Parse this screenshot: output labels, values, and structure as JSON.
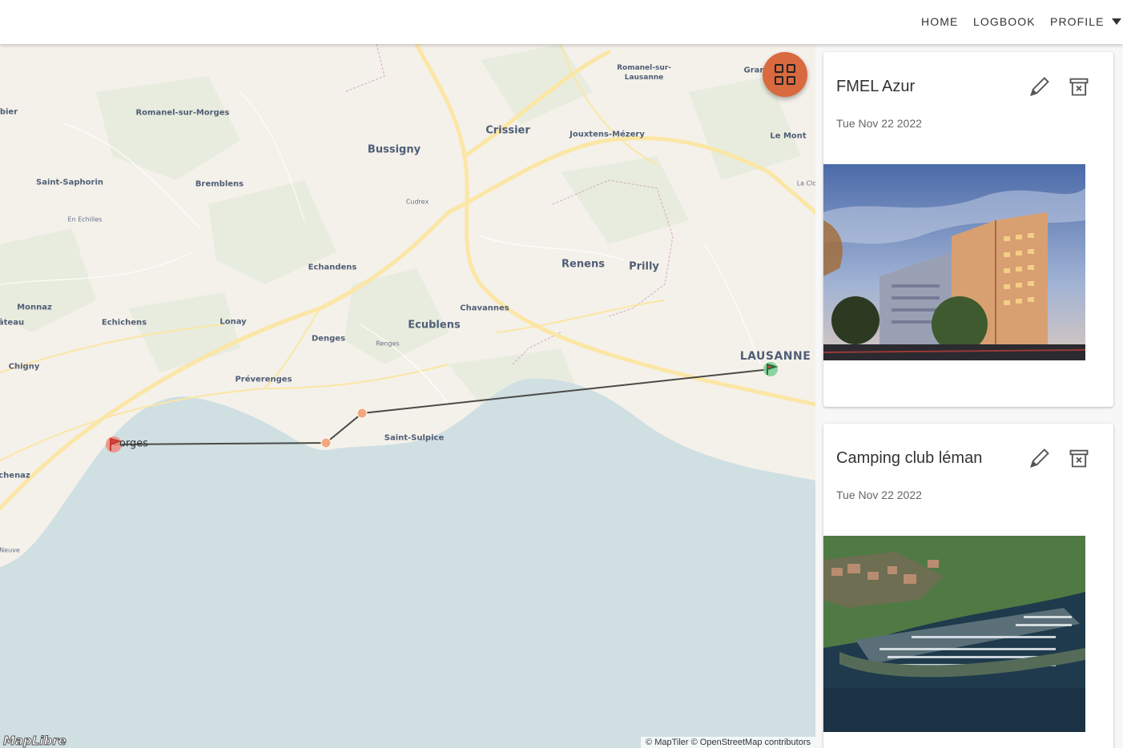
{
  "nav": {
    "home": "HOME",
    "logbook": "LOGBOOK",
    "profile": "PROFILE"
  },
  "map": {
    "places": {
      "romanel_lausanne_1": "Romanel-sur-",
      "romanel_lausanne_2": "Lausanne",
      "gran": "Gran",
      "bier": "bier",
      "romanel_morges": "Romanel-sur-Morges",
      "crissier": "Crissier",
      "jouxtens": "Jouxtens-Mézery",
      "le_mont": "Le Mont",
      "bussigny": "Bussigny",
      "saint_saphorin": "Saint-Saphorin",
      "bremblens": "Bremblens",
      "cudrex": "Cudrex",
      "la_clo": "La Clo",
      "en_echilles": "En Echilles",
      "echandens": "Echandens",
      "renens": "Renens",
      "prilly": "Prilly",
      "monnaz": "Monnaz",
      "chavannes": "Chavannes",
      "ateau": "âteau",
      "echichens": "Echichens",
      "lonay": "Lonay",
      "ecublens": "Ecublens",
      "denges": "Denges",
      "renges": "Renges",
      "lausanne": "LAUSANNE",
      "chigny": "Chigny",
      "preverenges": "Préverenges",
      "orges": "orges",
      "saint_sulpice": "Saint-Sulpice",
      "chenaz": "chenaz",
      "neuve": "Neuve"
    },
    "attribution": "© MapTiler © OpenStreetMap contributors",
    "logo": "MapLibre",
    "colors": {
      "land": "#f4f1ea",
      "water": "#cfdfe2",
      "route": "#4a4a48",
      "waypoint": "#f2a77c",
      "start_marker": "#f08a80",
      "end_marker": "#7fcf97",
      "accent": "#d9693e"
    },
    "fab_icon": "grid-view-icon"
  },
  "entries": [
    {
      "title": "FMEL Azur",
      "date": "Tue Nov 22 2022",
      "edit_icon": "pencil-icon",
      "delete_icon": "archive-delete-icon"
    },
    {
      "title": "Camping club léman",
      "date": "Tue Nov 22 2022",
      "edit_icon": "pencil-icon",
      "delete_icon": "archive-delete-icon"
    }
  ]
}
